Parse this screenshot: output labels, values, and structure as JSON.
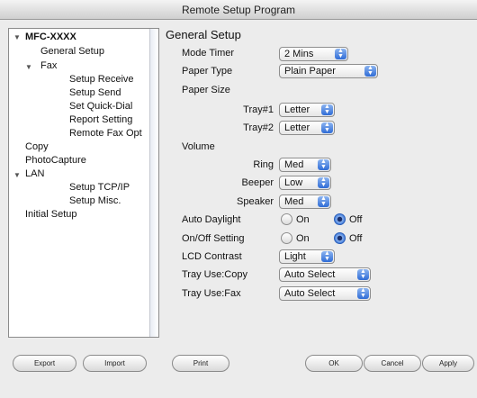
{
  "window": {
    "title": "Remote Setup Program"
  },
  "tree": {
    "items": [
      {
        "label": "MFC-XXXX",
        "bold": true
      },
      {
        "label": "General Setup"
      },
      {
        "label": "Fax"
      },
      {
        "label": "Setup Receive"
      },
      {
        "label": "Setup Send"
      },
      {
        "label": "Set Quick-Dial"
      },
      {
        "label": "Report Setting"
      },
      {
        "label": "Remote Fax Opt"
      },
      {
        "label": "Copy"
      },
      {
        "label": "PhotoCapture"
      },
      {
        "label": "LAN"
      },
      {
        "label": "Setup TCP/IP"
      },
      {
        "label": "Setup Misc."
      },
      {
        "label": "Initial Setup"
      }
    ]
  },
  "panel": {
    "heading": "General Setup",
    "mode_timer": {
      "label": "Mode Timer",
      "value": "2 Mins"
    },
    "paper_type": {
      "label": "Paper Type",
      "value": "Plain Paper"
    },
    "paper_size": {
      "label": "Paper Size"
    },
    "tray1": {
      "label": "Tray#1",
      "value": "Letter"
    },
    "tray2": {
      "label": "Tray#2",
      "value": "Letter"
    },
    "volume": {
      "label": "Volume"
    },
    "ring": {
      "label": "Ring",
      "value": "Med"
    },
    "beeper": {
      "label": "Beeper",
      "value": "Low"
    },
    "speaker": {
      "label": "Speaker",
      "value": "Med"
    },
    "auto_daylight": {
      "label": "Auto Daylight",
      "on": "On",
      "off": "Off",
      "selected": "Off"
    },
    "onoff_setting": {
      "label": "On/Off Setting",
      "on": "On",
      "off": "Off",
      "selected": "Off"
    },
    "lcd_contrast": {
      "label": "LCD Contrast",
      "value": "Light"
    },
    "tray_use_copy": {
      "label": "Tray Use:Copy",
      "value": "Auto Select"
    },
    "tray_use_fax": {
      "label": "Tray Use:Fax",
      "value": "Auto Select"
    }
  },
  "buttons": {
    "export": "Export",
    "import": "Import",
    "print": "Print",
    "ok": "OK",
    "cancel": "Cancel",
    "apply": "Apply"
  }
}
